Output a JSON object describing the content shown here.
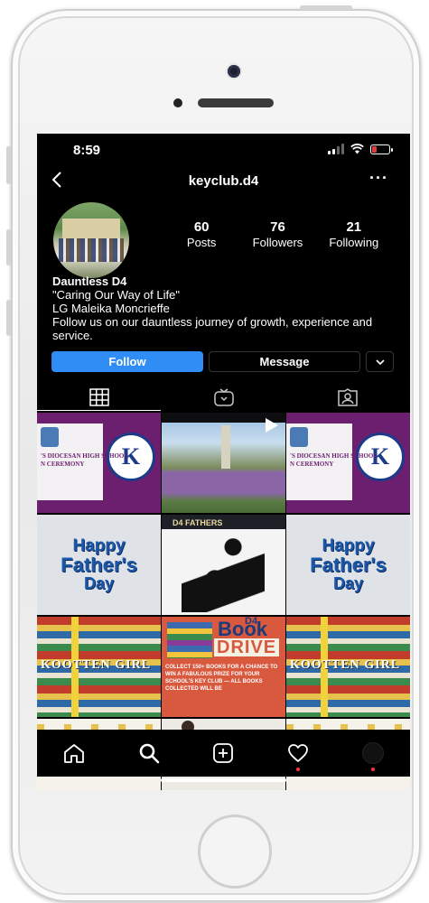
{
  "status_bar": {
    "time": "8:59"
  },
  "nav": {
    "back_icon": "chevron-left-icon",
    "title": "keyclub.d4",
    "more_icon": "more-horizontal-icon"
  },
  "profile": {
    "avatar_icon": "profile-photo",
    "stats": [
      {
        "num": "60",
        "label": "Posts"
      },
      {
        "num": "76",
        "label": "Followers"
      },
      {
        "num": "21",
        "label": "Following"
      }
    ],
    "name": "Dauntless D4",
    "bio": [
      "\"Caring Our Way of Life\"",
      "LG Maleika Moncrieffe",
      "Follow us on our dauntless journey of growth, experience and service."
    ]
  },
  "actions": {
    "follow": "Follow",
    "message": "Message"
  },
  "tabs": [
    "grid-icon",
    "igtv-icon",
    "tagged-icon"
  ],
  "grid": {
    "ceremony_text": "'S DIOCESAN HIGH SCHOOL",
    "ceremony_sub": "N CEREMONY",
    "ceremony_logo": "K",
    "fathers_header": "D4 FATHERS",
    "happy": "Happy",
    "fathers": "Father's",
    "day": "Day",
    "book_title": "KOOTTEN GIRL",
    "drive_d4": "D4",
    "drive_book": "Book",
    "drive_drive": "DRIVE",
    "drive_info": "COLLECT 150+ BOOKS FOR A CHANCE TO WIN A FABULOUS PRIZE FOR YOUR SCHOOL'S KEY CLUB — ALL BOOKS COLLECTED WILL BE"
  },
  "tabbar": [
    "home-icon",
    "search-icon",
    "add-post-icon",
    "heart-icon",
    "profile-icon"
  ],
  "colors": {
    "follow_blue": "#2f8df5",
    "notification_red": "#ff3040",
    "background": "#000000"
  }
}
